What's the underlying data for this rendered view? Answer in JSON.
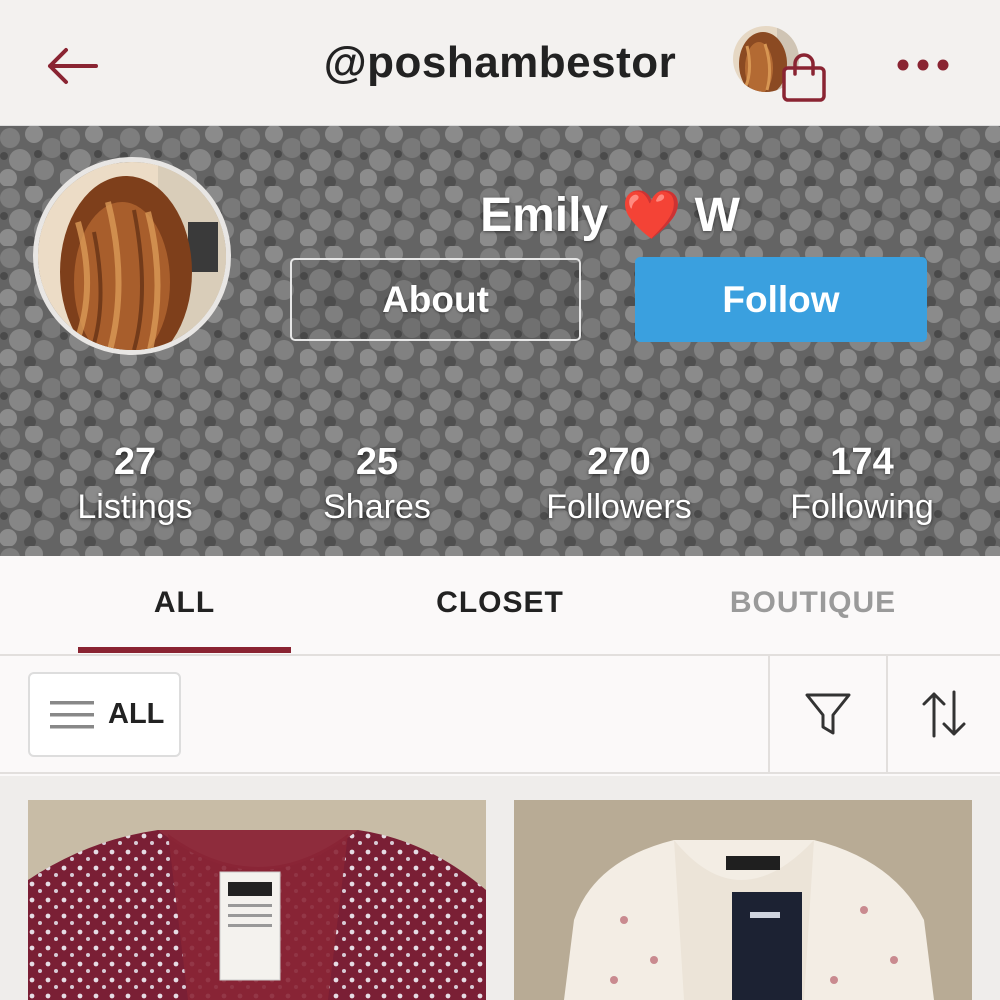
{
  "header": {
    "username": "@poshambestor",
    "back_icon": "arrow-left-icon",
    "bag_icon": "shopping-bag-icon",
    "more_icon": "more-dots-icon"
  },
  "profile": {
    "name_first": "Emily",
    "name_heart": "❤️",
    "name_last": "W",
    "about_label": "About",
    "follow_label": "Follow"
  },
  "stats": [
    {
      "value": "27",
      "label": "Listings"
    },
    {
      "value": "25",
      "label": "Shares"
    },
    {
      "value": "270",
      "label": "Followers"
    },
    {
      "value": "174",
      "label": "Following"
    }
  ],
  "tabs": [
    {
      "label": "ALL",
      "active": true
    },
    {
      "label": "CLOSET",
      "active": false
    },
    {
      "label": "BOUTIQUE",
      "active": false
    }
  ],
  "filter_bar": {
    "category_label": "ALL",
    "menu_icon": "hamburger-menu-icon",
    "filter_icon": "funnel-filter-icon",
    "sort_icon": "sort-arrows-icon"
  },
  "colors": {
    "accent": "#8a2432",
    "follow_button": "#3aa0df",
    "inactive_tab": "#9a9a9a"
  }
}
